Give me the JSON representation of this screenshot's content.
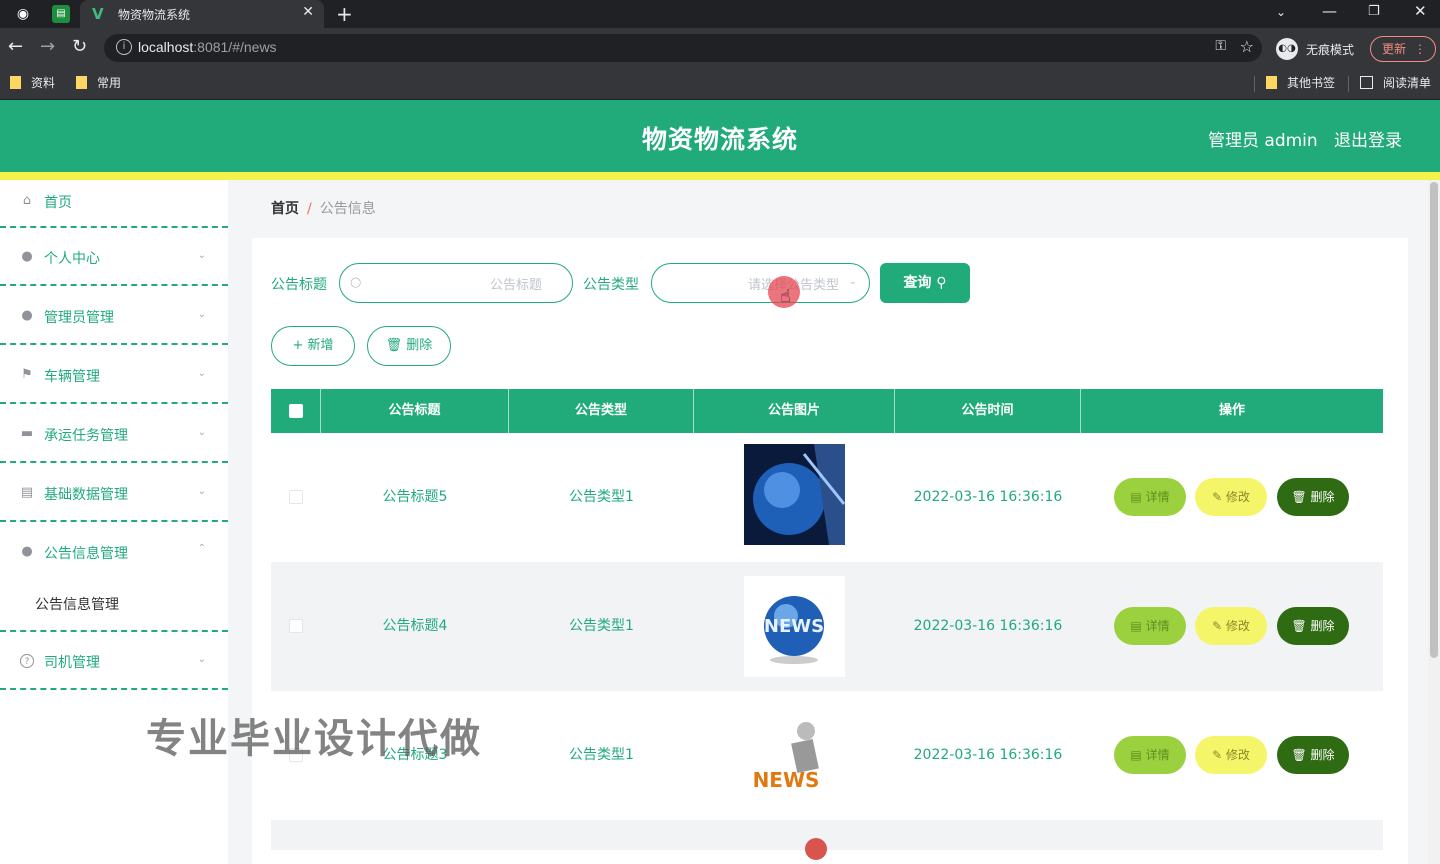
{
  "browser": {
    "tab_title": "物资物流系统",
    "url_host": "localhost",
    "url_rest": ":8081/#/news",
    "incognito_label": "无痕模式",
    "update_label": "更新",
    "bookmarks": [
      "资料",
      "常用"
    ],
    "bookmarks_right": [
      "其他书签",
      "阅读清单"
    ]
  },
  "header": {
    "title": "物资物流系统",
    "user": "管理员 admin",
    "logout": "退出登录"
  },
  "sidebar": {
    "items": [
      {
        "label": "首页",
        "icon": "home-icon"
      },
      {
        "label": "个人中心",
        "icon": "user-icon"
      },
      {
        "label": "管理员管理",
        "icon": "admin-icon"
      },
      {
        "label": "车辆管理",
        "icon": "flag-icon"
      },
      {
        "label": "承运任务管理",
        "icon": "chat-icon"
      },
      {
        "label": "基础数据管理",
        "icon": "box-icon"
      },
      {
        "label": "公告信息管理",
        "icon": "bulb-icon"
      },
      {
        "label": "司机管理",
        "icon": "help-icon"
      }
    ],
    "submenu": "公告信息管理"
  },
  "breadcrumb": {
    "home": "首页",
    "separator": "/",
    "current": "公告信息"
  },
  "filters": {
    "title_label": "公告标题",
    "title_placeholder": "公告标题",
    "type_label": "公告类型",
    "type_placeholder": "请选择公告类型",
    "query_label": "查询 ⚲"
  },
  "actions": {
    "add": "+ 新增",
    "delete": "🗑 删除"
  },
  "table": {
    "columns": [
      "公告标题",
      "公告类型",
      "公告图片",
      "公告时间",
      "操作"
    ],
    "rows": [
      {
        "title": "公告标题5",
        "type": "公告类型1",
        "time": "2022-03-16 16:36:16"
      },
      {
        "title": "公告标题4",
        "type": "公告类型1",
        "time": "2022-03-16 16:36:16"
      },
      {
        "title": "公告标题3",
        "type": "公告类型1",
        "time": "2022-03-16 16:36:16"
      }
    ],
    "btn_detail": "▤ 详情",
    "btn_edit": "✎ 修改",
    "btn_delete": "🗑 删除"
  },
  "watermark": "专业毕业设计代做",
  "colors": {
    "primary": "#21ab7a",
    "accent_yellow": "#f2f24a",
    "detail_btn": "#9bd03f",
    "edit_btn": "#f5f56a",
    "delete_btn": "#2e6b12"
  }
}
